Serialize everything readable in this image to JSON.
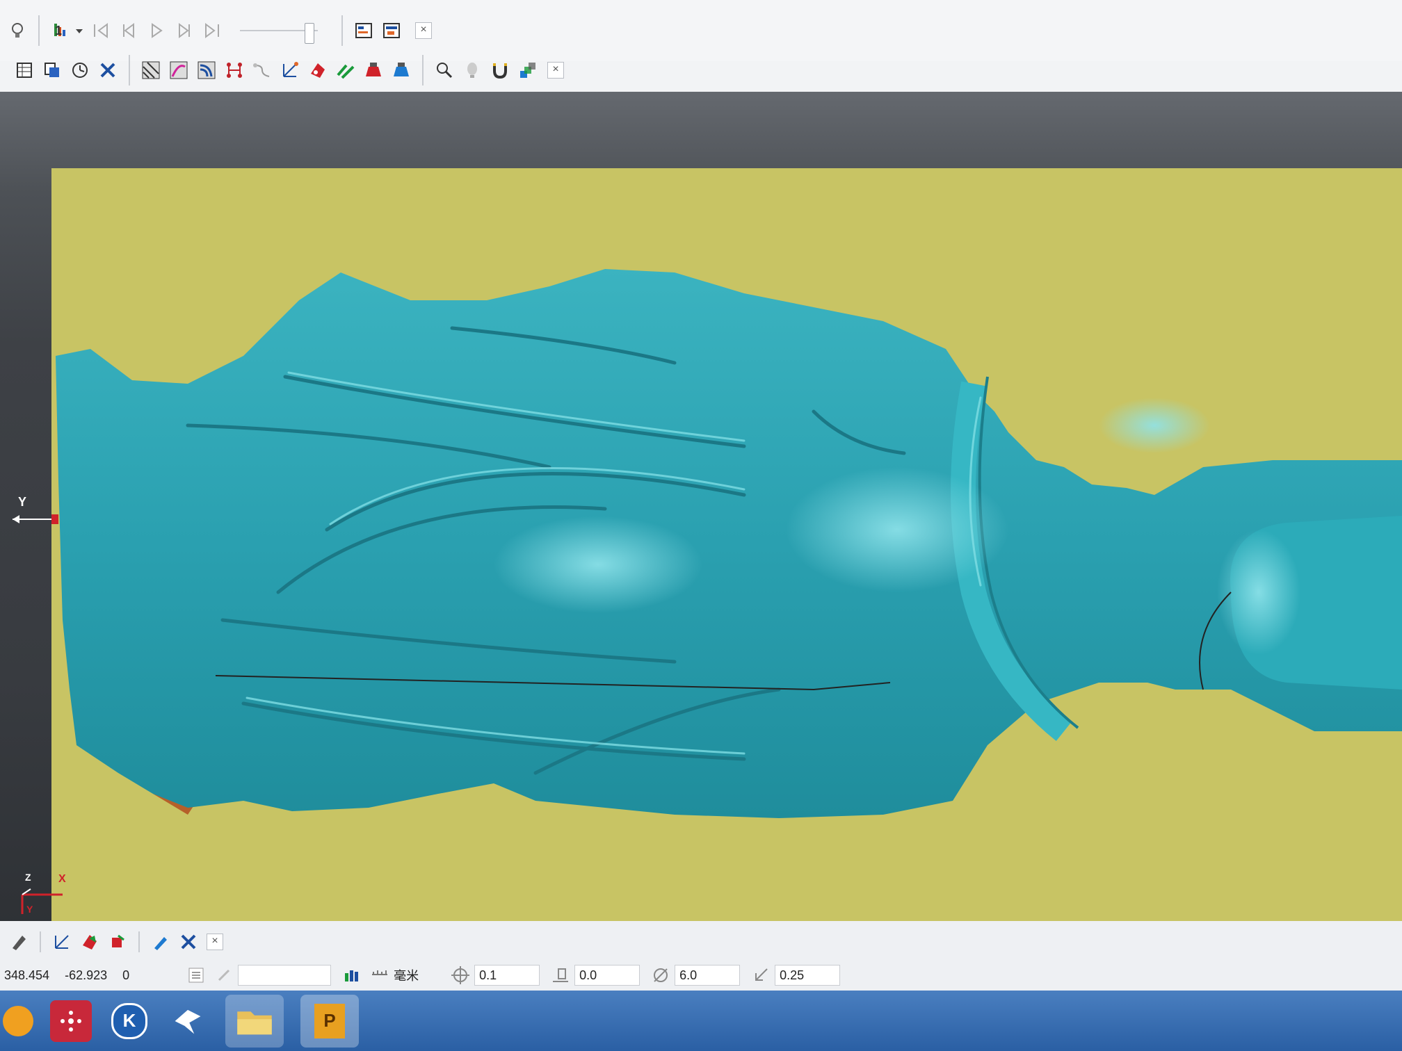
{
  "toolbar_top": {
    "items": [
      "lightbulb-icon",
      "toolpath-select-icon",
      "dropdown-arrow-icon",
      "first-frame-icon",
      "prev-frame-icon",
      "play-icon",
      "next-frame-icon",
      "last-frame-icon",
      "panel-a-icon",
      "panel-b-icon"
    ],
    "step_label": "1"
  },
  "toolbar_second": {
    "items": [
      "table-icon",
      "copy-icon",
      "clock-icon",
      "tools-icon",
      "stripe-a-icon",
      "stripe-b-icon",
      "stripe-c-icon",
      "dots-icon",
      "curve-icon",
      "measure-icon",
      "red-mark-icon",
      "green-diag-icon",
      "red-tool-icon",
      "blue-tool-icon",
      "magnify-icon",
      "bulb-gray-icon",
      "magnet-icon",
      "stack-icon"
    ]
  },
  "viewport": {
    "axis_y": "Y",
    "axis_z": "Z",
    "axis_x": "X",
    "axis_y2": "Y",
    "colors": {
      "stock": "#c8c464",
      "model": "#2ea7b6",
      "background": "#3e4146"
    }
  },
  "status": {
    "coord_x": "348.454",
    "coord_y": "-62.923",
    "coord_z": "0",
    "unit": "毫米",
    "tolerance": "0.1",
    "thickness": "0.0",
    "diameter": "6.0",
    "stepover": "0.25"
  },
  "taskbar": {
    "apps": [
      "start-orb-icon",
      "red-app-icon",
      "k-app-icon",
      "bird-app-icon",
      "folder-icon",
      "p-app-icon"
    ],
    "p_label": "P",
    "k_label": "K"
  }
}
